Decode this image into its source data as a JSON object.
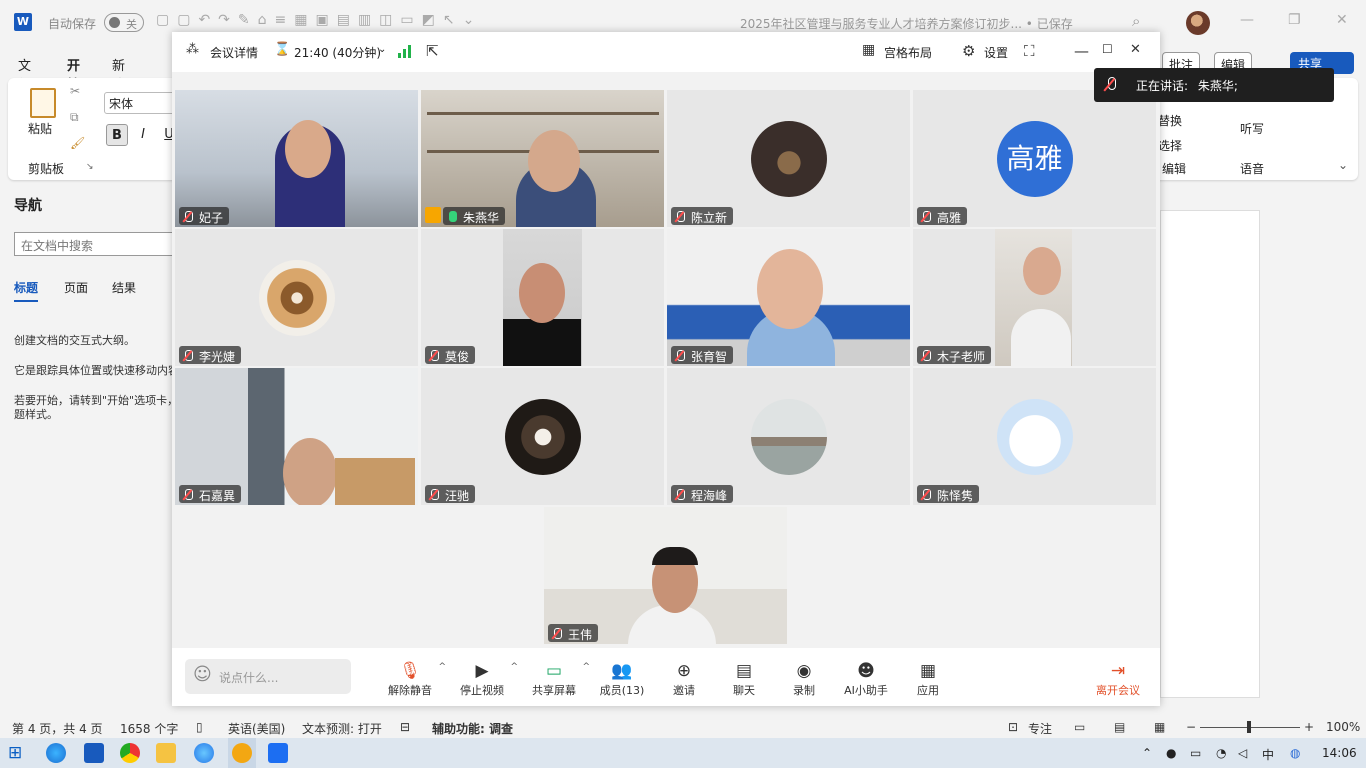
{
  "word": {
    "autosave_label": "自动保存",
    "autosave_state": "关",
    "doc_title": "2025年社区管理与服务专业人才培养方案修订初步... • 已保存",
    "menu": [
      "文件",
      "开始",
      "新建选项卡"
    ],
    "ribbon": {
      "paste": "粘贴",
      "clipboard": "剪贴板",
      "font_name": "宋体",
      "bold": "B",
      "italic": "I",
      "underline": "U",
      "replace": "替换",
      "select": "选择",
      "edit_group": "编辑",
      "dictate": "听写",
      "voice_group": "语音",
      "comment_btn": "批注",
      "edit_btn": "编辑",
      "share_btn": "共享"
    },
    "nav": {
      "title": "导航",
      "search_placeholder": "在文档中搜索",
      "tabs": [
        "标题",
        "页面",
        "结果"
      ],
      "text1": "创建文档的交互式大纲。",
      "text2": "它是跟踪具体位置或快速移动内容的好方法。",
      "text3a": "若要开始，请转到\"开始\"选项卡，",
      "text3b": "题样式。"
    },
    "status": {
      "page": "第 4 页，共 4 页",
      "words": "1658 个字",
      "lang": "英语(美国)",
      "predict": "文本预测: 打开",
      "access": "辅助功能: 调查",
      "focus": "专注",
      "zoom": "100%"
    }
  },
  "meeting": {
    "details": "会议详情",
    "timer": "21:40 (40分钟)",
    "layout": "宫格布局",
    "settings": "设置",
    "speaking_label": "正在讲话:",
    "speaking_name": "朱燕华;",
    "participants": [
      {
        "name": "妃子",
        "type": "video"
      },
      {
        "name": "朱燕华",
        "type": "video",
        "speaking": true,
        "host": true
      },
      {
        "name": "陈立新",
        "type": "avatar"
      },
      {
        "name": "高雅",
        "type": "text-avatar",
        "avatar_text": "高雅"
      },
      {
        "name": "李光婕",
        "type": "avatar"
      },
      {
        "name": "莫俊",
        "type": "video"
      },
      {
        "name": "张育智",
        "type": "video"
      },
      {
        "name": "木子老师",
        "type": "video"
      },
      {
        "name": "石嘉異",
        "type": "video"
      },
      {
        "name": "汪驰",
        "type": "avatar"
      },
      {
        "name": "程海峰",
        "type": "avatar"
      },
      {
        "name": "陈怿隽",
        "type": "avatar"
      },
      {
        "name": "王伟",
        "type": "video"
      }
    ],
    "controls": {
      "chat_placeholder": "说点什么...",
      "unmute": "解除静音",
      "stop_video": "停止视频",
      "share": "共享屏幕",
      "members": "成员(13)",
      "invite": "邀请",
      "chat": "聊天",
      "record": "录制",
      "ai": "AI小助手",
      "apps": "应用",
      "leave": "离开会议"
    }
  },
  "taskbar": {
    "time": "14:06",
    "ime": "中"
  },
  "colors": {
    "word_blue": "#185abd",
    "speaking_green": "#2fb86b",
    "mute_red": "#ff4d4d",
    "leave_orange": "#e2502a",
    "text_avatar_blue": "#2f6fd6"
  }
}
